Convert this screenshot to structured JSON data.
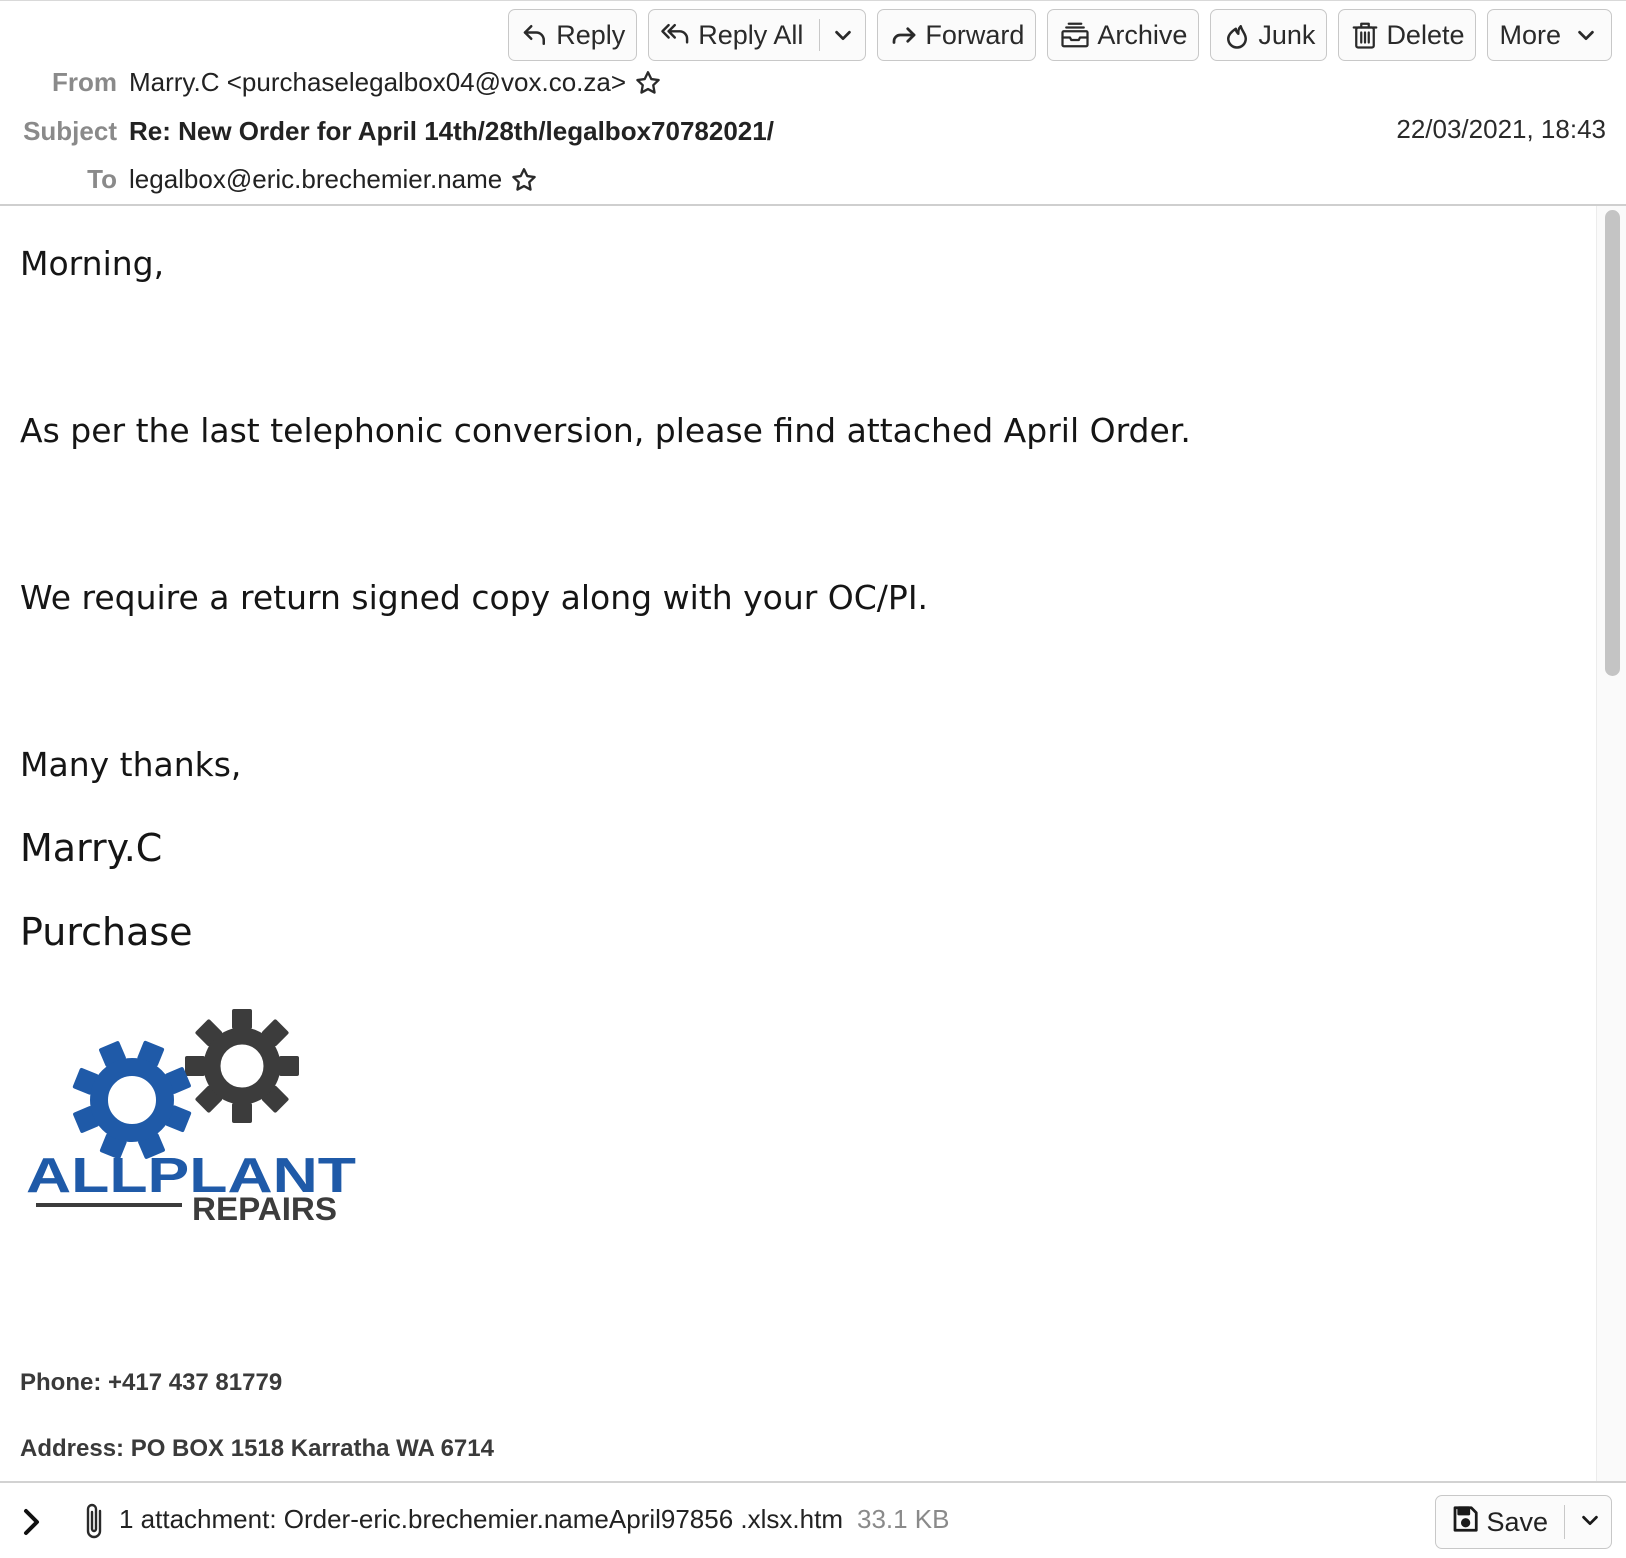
{
  "toolbar": {
    "reply": "Reply",
    "reply_all": "Reply All",
    "forward": "Forward",
    "archive": "Archive",
    "junk": "Junk",
    "delete": "Delete",
    "more": "More"
  },
  "header": {
    "from_label": "From",
    "from_value": "Marry.C <purchaselegalbox04@vox.co.za>",
    "subject_label": "Subject",
    "subject_value": "Re: New Order for April 14th/28th/legalbox70782021/",
    "date": "22/03/2021, 18:43",
    "to_label": "To",
    "to_value": "legalbox@eric.brechemier.name"
  },
  "body": {
    "greeting": "Morning,",
    "line1": "As per the last telephonic conversion, please find attached April Order.",
    "line2": "We require a return signed copy along with your OC/PI.",
    "closing": "Many thanks,",
    "name": "Marry.C",
    "role": "Purchase",
    "logo_text_main": "ALLPLANT",
    "logo_text_sub": "REPAIRS",
    "phone": "Phone: +417 437 81779",
    "address": "Address: PO BOX 1518 Karratha WA 6714"
  },
  "attachment": {
    "text": "1 attachment: Order-eric.brechemier.nameApril97856 .xlsx.htm",
    "size": "33.1 KB",
    "save_label": "Save"
  },
  "colors": {
    "logo_blue": "#1f5aa8",
    "logo_gray": "#3c3c3c"
  }
}
